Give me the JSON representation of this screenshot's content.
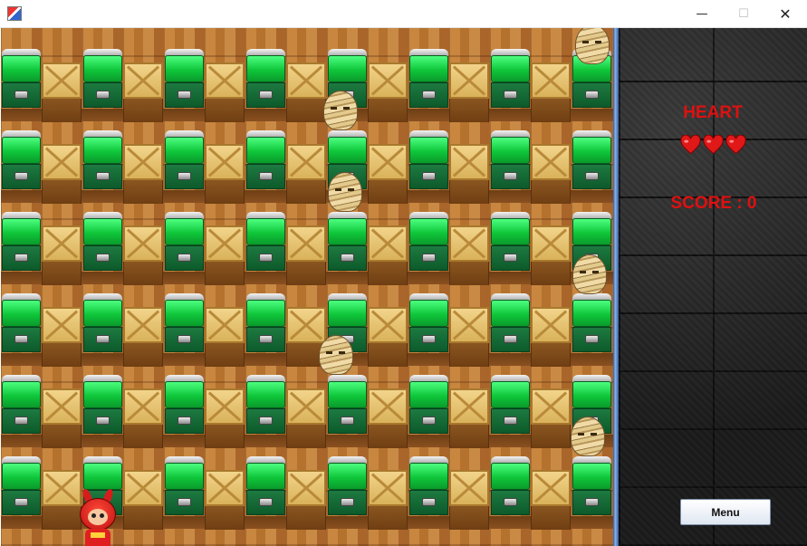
{
  "window": {
    "title": ""
  },
  "window_controls": {
    "minimize": "—",
    "maximize": "☐",
    "close": "✕"
  },
  "sidebar": {
    "heart_label": "HEART",
    "hearts": [
      "heart",
      "heart",
      "heart"
    ],
    "score_text": "SCORE : 0",
    "menu_label": "Menu"
  },
  "colors": {
    "hud_red": "#e01010",
    "cabinet_green": "#0fc63a",
    "crate": "#e5c06e",
    "wood": "#b5722e"
  }
}
